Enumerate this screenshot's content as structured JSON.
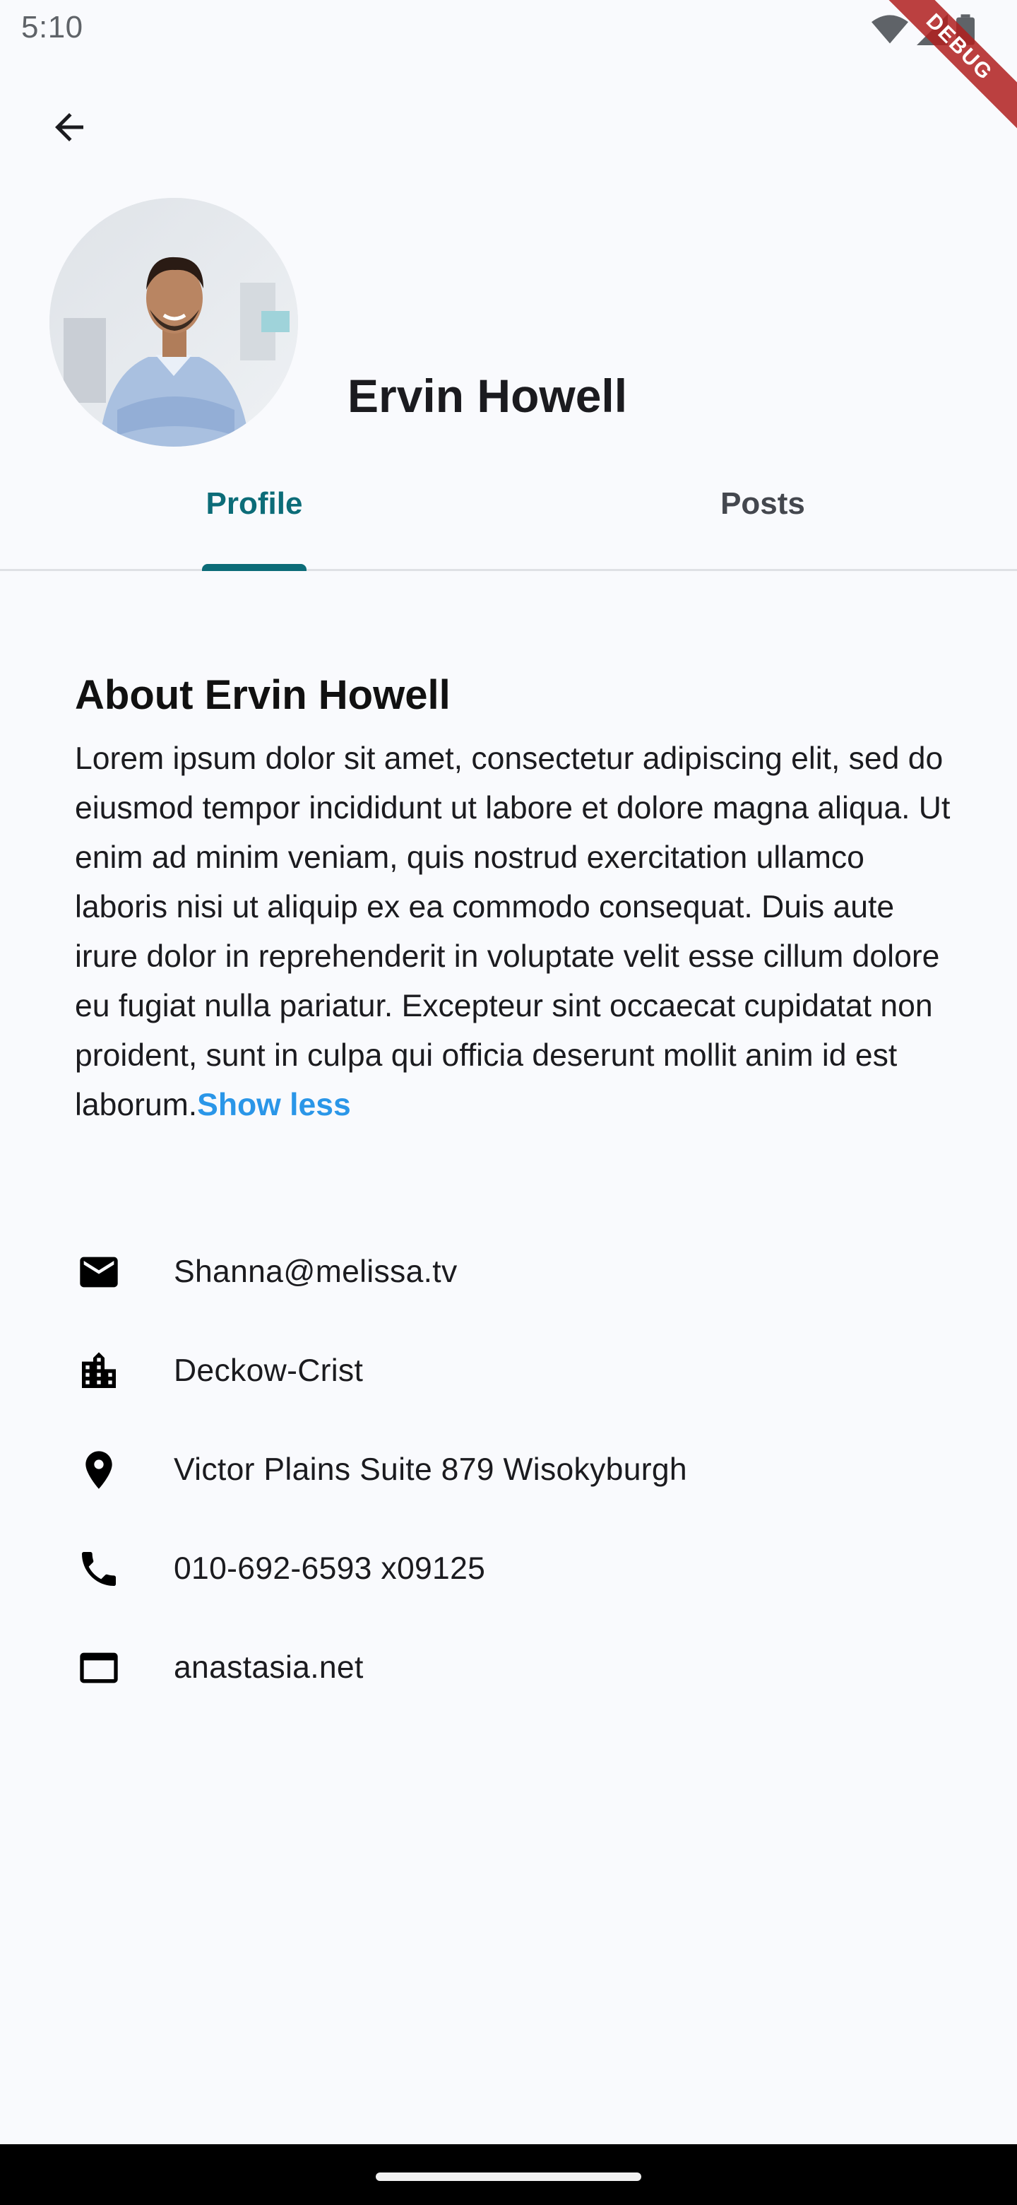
{
  "status_bar": {
    "time": "5:10",
    "icons": [
      "wifi-icon",
      "signal-icon",
      "battery-icon"
    ]
  },
  "debug_banner": {
    "label": "DEBUG",
    "color": "#b01e1e"
  },
  "header": {
    "back_icon": "arrow-back-icon",
    "name": "Ervin Howell",
    "avatar": "profile-photo"
  },
  "tabs": [
    {
      "label": "Profile",
      "active": true
    },
    {
      "label": "Posts",
      "active": false
    }
  ],
  "about": {
    "title": "About Ervin Howell",
    "text": "Lorem ipsum dolor sit amet, consectetur adipiscing elit, sed do eiusmod tempor incididunt ut labore et dolore magna aliqua. Ut enim ad minim veniam, quis nostrud exercitation ullamco laboris nisi ut aliquip ex ea commodo consequat. Duis aute irure dolor in reprehenderit in voluptate velit esse cillum dolore eu fugiat nulla pariatur. Excepteur sint occaecat cupidatat non proident, sunt in culpa qui officia deserunt mollit anim id est laborum.",
    "toggle_label": "Show less"
  },
  "contact": {
    "email": {
      "icon": "email-icon",
      "value": "Shanna@melissa.tv"
    },
    "company": {
      "icon": "company-icon",
      "value": "Deckow-Crist"
    },
    "address": {
      "icon": "location-icon",
      "value": "Victor Plains Suite 879 Wisokyburgh"
    },
    "phone": {
      "icon": "phone-icon",
      "value": "010-692-6593 x09125"
    },
    "website": {
      "icon": "web-icon",
      "value": "anastasia.net"
    }
  },
  "colors": {
    "accent": "#0c6c78",
    "link": "#2a96e8",
    "background": "#f9fafd"
  }
}
